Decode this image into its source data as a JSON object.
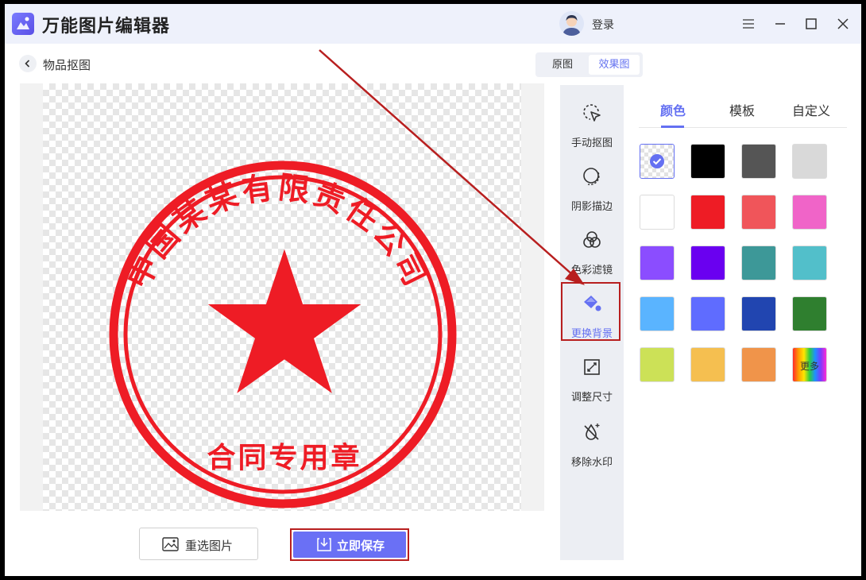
{
  "app": {
    "title": "万能图片编辑器",
    "login_label": "登录"
  },
  "header": {
    "page_title": "物品抠图",
    "view_original": "原图",
    "view_result": "效果图"
  },
  "stamp": {
    "company_text": "中国某某有限责任公司",
    "bottom_text": "合同专用章",
    "color": "#ee1c25"
  },
  "actions": {
    "reselect_label": "重选图片",
    "save_label": "立即保存"
  },
  "tools": [
    {
      "label": "手动抠图",
      "icon": "cursor-select-icon"
    },
    {
      "label": "阴影描边",
      "icon": "shadow-outline-icon"
    },
    {
      "label": "色彩滤镜",
      "icon": "color-filter-icon"
    },
    {
      "label": "更换背景",
      "icon": "paint-bucket-icon",
      "active": true
    },
    {
      "label": "调整尺寸",
      "icon": "resize-icon"
    },
    {
      "label": "移除水印",
      "icon": "remove-watermark-icon"
    }
  ],
  "panel": {
    "tabs": [
      "颜色",
      "模板",
      "自定义"
    ],
    "active_tab": "颜色",
    "swatches": [
      {
        "color": "transparent",
        "selected": true
      },
      {
        "color": "#000000"
      },
      {
        "color": "#555555"
      },
      {
        "color": "#d9d9d9"
      },
      {
        "color": "#ffffff"
      },
      {
        "color": "#ee1c25"
      },
      {
        "color": "#f0555a"
      },
      {
        "color": "#f064c8"
      },
      {
        "color": "#8b4dff"
      },
      {
        "color": "#6a00f0"
      },
      {
        "color": "#3d9898"
      },
      {
        "color": "#52bfca"
      },
      {
        "color": "#5ab4ff"
      },
      {
        "color": "#5f6cff"
      },
      {
        "color": "#2145b0"
      },
      {
        "color": "#2f7f2f"
      },
      {
        "color": "#cce157"
      },
      {
        "color": "#f5bf50"
      },
      {
        "color": "#f0944a"
      },
      {
        "color": "rainbow",
        "label": "更多"
      }
    ]
  },
  "colors": {
    "accent": "#6470f2",
    "highlight_border": "#b81f1f"
  }
}
